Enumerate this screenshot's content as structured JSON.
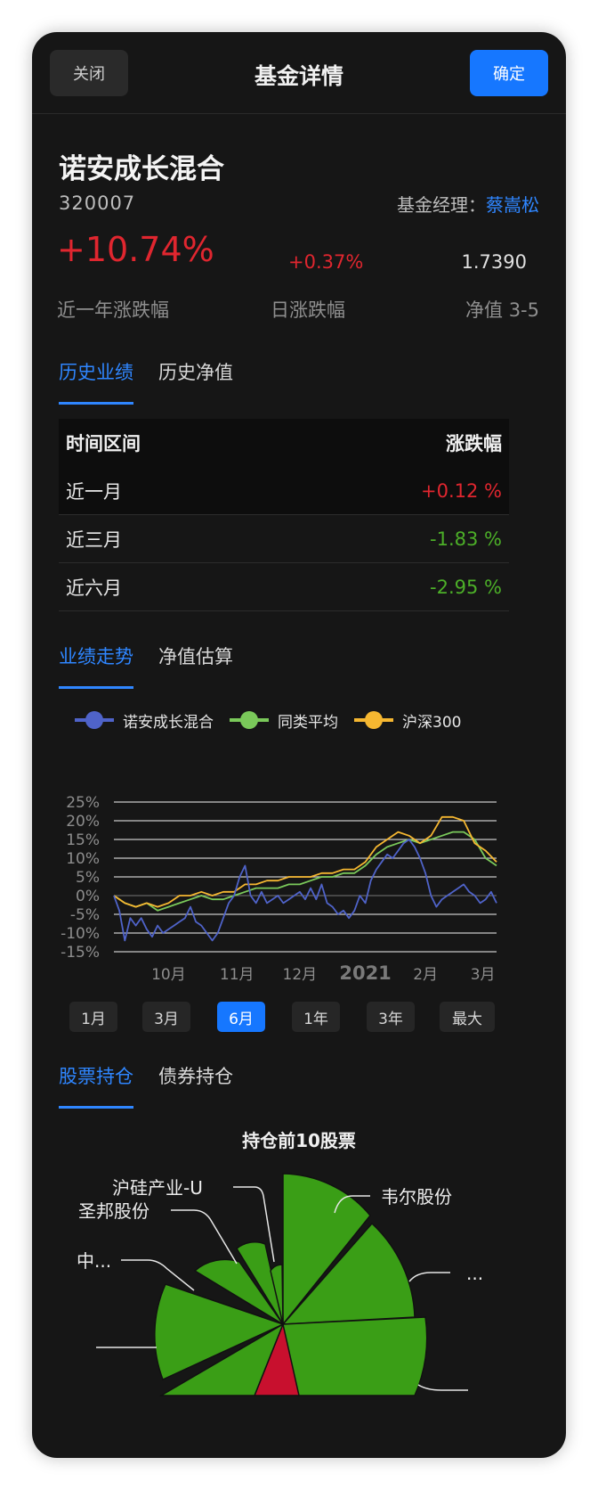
{
  "header": {
    "close_label": "关闭",
    "title": "基金详情",
    "confirm_label": "确定"
  },
  "fund": {
    "name": "诺安成长混合",
    "code": "320007",
    "manager_label": "基金经理：",
    "manager_name": "蔡嵩松",
    "year_change": "+10.74%",
    "year_change_label": "近一年涨跌幅",
    "day_change": "+0.37%",
    "day_change_label": "日涨跌幅",
    "nav": "1.7390",
    "nav_label": "净值 3-5"
  },
  "perf_tabs": [
    {
      "label": "历史业绩",
      "active": true
    },
    {
      "label": "历史净值",
      "active": false
    }
  ],
  "perf_table": {
    "headers": [
      "时间区间",
      "涨跌幅"
    ],
    "rows": [
      {
        "period": "近一月",
        "change": "+0.12 %",
        "dir": "up"
      },
      {
        "period": "近三月",
        "change": "-1.83 %",
        "dir": "down"
      },
      {
        "period": "近六月",
        "change": "-2.95 %",
        "dir": "down"
      }
    ]
  },
  "trend_tabs": [
    {
      "label": "业绩走势",
      "active": true
    },
    {
      "label": "净值估算",
      "active": false
    }
  ],
  "chart_data": {
    "type": "line",
    "yticks": [
      "25%",
      "20%",
      "15%",
      "10%",
      "5%",
      "0%",
      "-5%",
      "-10%",
      "-15%"
    ],
    "ylim": [
      -15,
      25
    ],
    "xlim": [
      0,
      140
    ],
    "xticks": [
      {
        "label": "10月",
        "t": 20
      },
      {
        "label": "11月",
        "t": 45
      },
      {
        "label": "12月",
        "t": 68
      },
      {
        "label": "2021",
        "t": 92,
        "bold": true
      },
      {
        "label": "2月",
        "t": 114
      },
      {
        "label": "3月",
        "t": 135
      }
    ],
    "series": [
      {
        "name": "诺安成长混合",
        "color": "#4f63c9",
        "x": [
          0,
          2,
          4,
          6,
          8,
          10,
          12,
          14,
          16,
          18,
          20,
          22,
          24,
          26,
          28,
          30,
          32,
          34,
          36,
          38,
          40,
          42,
          44,
          46,
          48,
          50,
          52,
          54,
          56,
          58,
          60,
          62,
          64,
          66,
          68,
          70,
          72,
          74,
          76,
          78,
          80,
          82,
          84,
          86,
          88,
          90,
          92,
          94,
          96,
          98,
          100,
          102,
          104,
          106,
          108,
          110,
          112,
          114,
          116,
          118,
          120,
          122,
          124,
          126,
          128,
          130,
          132,
          134,
          136,
          138,
          140
        ],
        "y": [
          0,
          -4,
          -12,
          -6,
          -8,
          -6,
          -9,
          -11,
          -8,
          -10,
          -9,
          -8,
          -7,
          -6,
          -3,
          -7,
          -8,
          -10,
          -12,
          -10,
          -6,
          -2,
          0,
          5,
          8,
          0,
          -2,
          1,
          -2,
          -1,
          0,
          -2,
          -1,
          0,
          1,
          -1,
          2,
          -1,
          3,
          -2,
          -3,
          -5,
          -4,
          -6,
          -4,
          0,
          -2,
          4,
          7,
          9,
          11,
          10,
          12,
          14,
          15,
          13,
          10,
          6,
          0,
          -3,
          -1,
          0,
          1,
          2,
          3,
          1,
          0,
          -2,
          -1,
          1,
          -2
        ]
      },
      {
        "name": "同类平均",
        "color": "#7ac95a",
        "x": [
          0,
          4,
          8,
          12,
          16,
          20,
          24,
          28,
          32,
          36,
          40,
          44,
          48,
          52,
          56,
          60,
          64,
          68,
          72,
          76,
          80,
          84,
          88,
          92,
          96,
          100,
          104,
          108,
          112,
          116,
          120,
          124,
          128,
          132,
          136,
          140
        ],
        "y": [
          0,
          -2,
          -3,
          -2,
          -4,
          -3,
          -2,
          -1,
          0,
          -1,
          -1,
          0,
          1,
          2,
          2,
          2,
          3,
          3,
          4,
          5,
          5,
          6,
          6,
          8,
          11,
          13,
          14,
          15,
          14,
          15,
          16,
          17,
          17,
          15,
          10,
          8
        ]
      },
      {
        "name": "沪深300",
        "color": "#f5b731",
        "x": [
          0,
          4,
          8,
          12,
          16,
          20,
          24,
          28,
          32,
          36,
          40,
          44,
          48,
          52,
          56,
          60,
          64,
          68,
          72,
          76,
          80,
          84,
          88,
          92,
          96,
          100,
          104,
          108,
          112,
          116,
          120,
          124,
          128,
          132,
          136,
          140
        ],
        "y": [
          0,
          -2,
          -3,
          -2,
          -3,
          -2,
          0,
          0,
          1,
          0,
          1,
          1,
          3,
          3,
          4,
          4,
          5,
          5,
          5,
          6,
          6,
          7,
          7,
          9,
          13,
          15,
          17,
          16,
          14,
          16,
          21,
          21,
          20,
          14,
          12,
          9
        ]
      }
    ]
  },
  "range_buttons": [
    {
      "label": "1月",
      "active": false
    },
    {
      "label": "3月",
      "active": false
    },
    {
      "label": "6月",
      "active": true
    },
    {
      "label": "1年",
      "active": false
    },
    {
      "label": "3年",
      "active": false
    },
    {
      "label": "最大",
      "active": false
    }
  ],
  "holding_tabs": [
    {
      "label": "股票持仓",
      "active": true
    },
    {
      "label": "债券持仓",
      "active": false
    }
  ],
  "holdings": {
    "title": "持仓前10股票",
    "labels": [
      "沪硅产业-U",
      "圣邦股份",
      "中...",
      "韦尔股份",
      "..."
    ],
    "colors": {
      "primary": "#3a9e16",
      "highlight": "#c8102e"
    }
  }
}
